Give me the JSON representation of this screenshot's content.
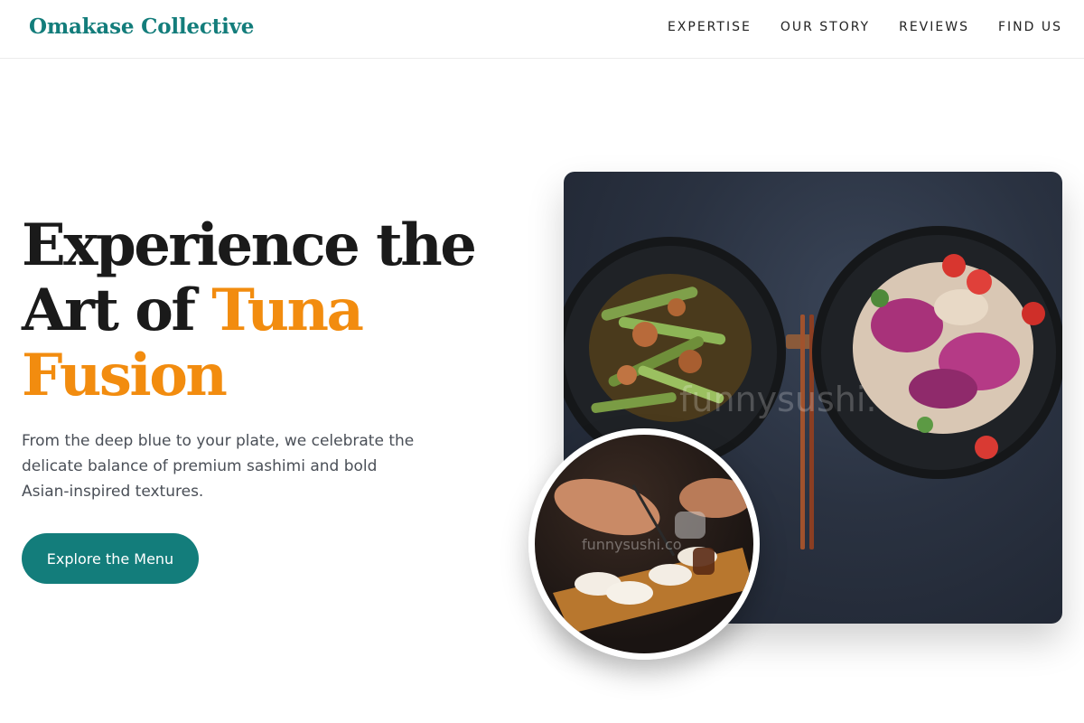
{
  "header": {
    "brand": "Omakase Collective",
    "nav": [
      "EXPERTISE",
      "OUR STORY",
      "REVIEWS",
      "FIND US"
    ]
  },
  "hero": {
    "title_line1": "Experience the",
    "title_line2_plain": "Art of",
    "title_accent_a": "Tuna",
    "title_accent_b": "Fusion",
    "subtitle": "From the deep blue to your plate, we celebrate the delicate balance of premium sashimi and bold Asian-inspired textures.",
    "cta_label": "Explore the Menu"
  },
  "images": {
    "main_watermark": "funnysushi.",
    "inset_watermark": "funnysushi.co"
  },
  "colors": {
    "brand": "#137d7b",
    "accent": "#f28c0f",
    "text": "#1a1a1a",
    "muted": "#4a4f57"
  }
}
